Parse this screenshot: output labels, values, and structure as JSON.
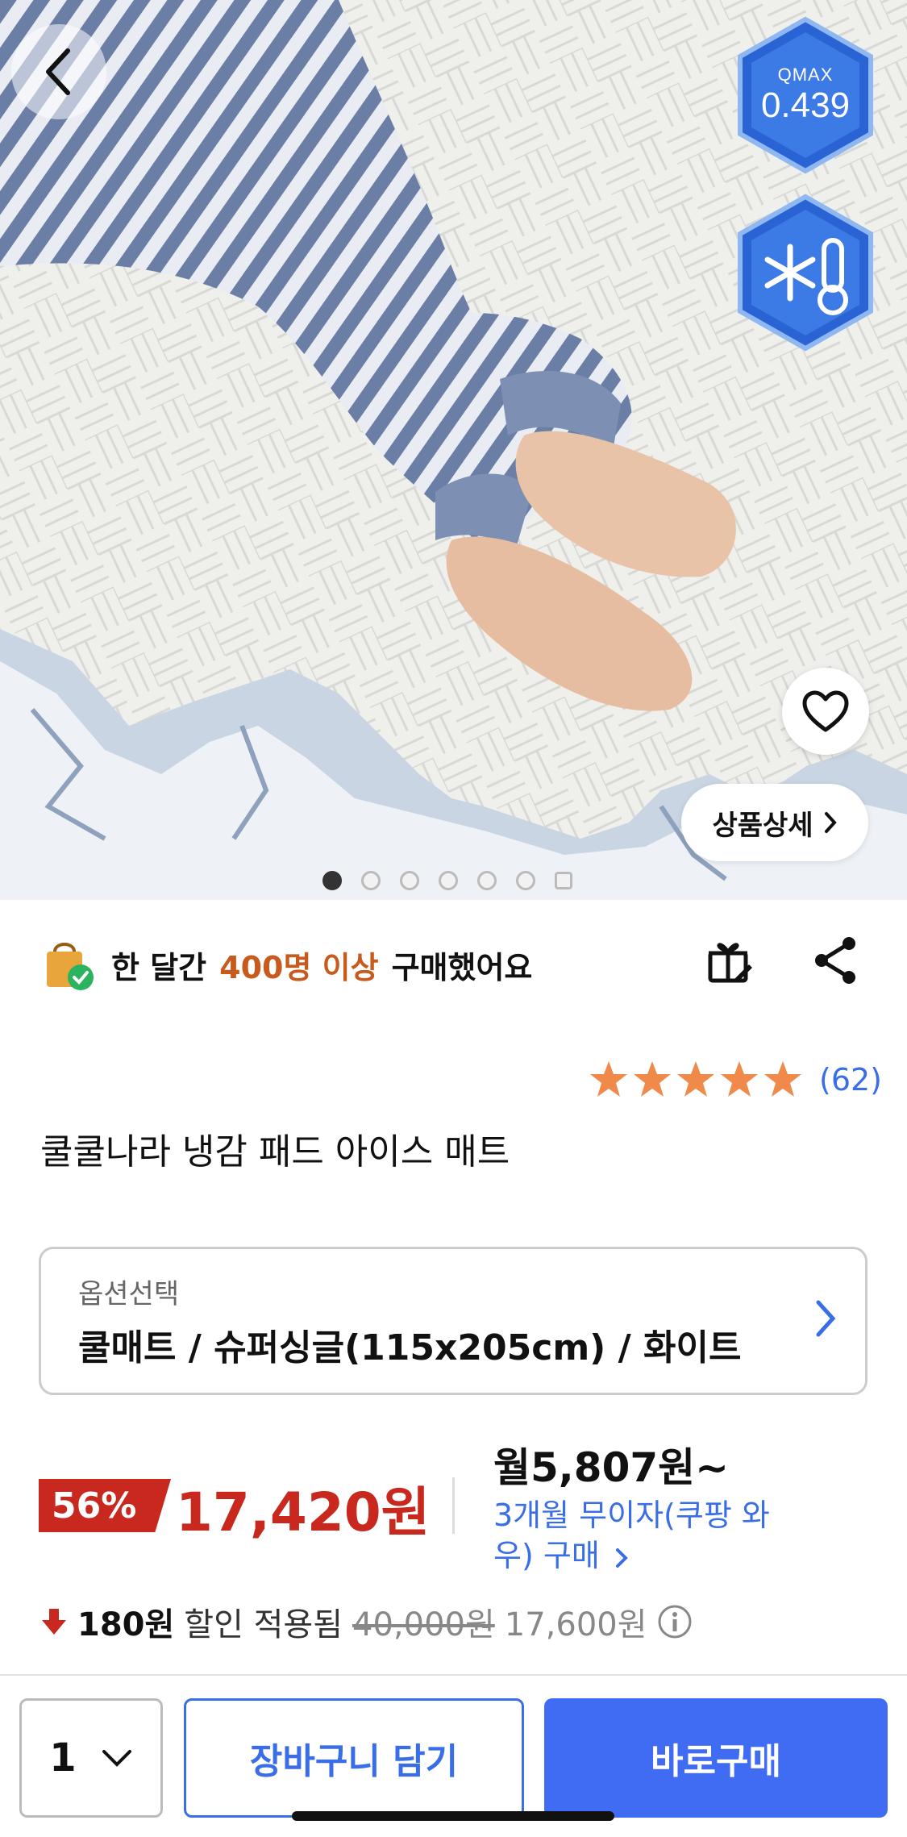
{
  "hero": {
    "badge_qmax_label": "QMAX",
    "badge_qmax_value": "0.439",
    "detail_label": "상품상세",
    "slide_count": 7,
    "active_slide": 1
  },
  "banner": {
    "text_before": "한 달간",
    "highlight": "400명 이상",
    "text_after": "구매했어요"
  },
  "product": {
    "rating_stars": 5,
    "rating_count": "(62)",
    "title": "쿨쿨나라 냉감 패드 아이스 매트"
  },
  "option": {
    "label": "옵션선택",
    "value": "쿨매트 / 슈퍼싱글(115x205cm) / 화이트"
  },
  "price": {
    "discount_rate": "56%",
    "sale_price": "17,420원",
    "monthly": "월5,807원~",
    "monthly_sub": "3개월 무이자(쿠팡 와우) 구매",
    "discount_amount": "180원",
    "discount_applied": "할인 적용됨",
    "original_price": "40,000원",
    "before_coupon": "17,600원"
  },
  "bottom": {
    "quantity": "1",
    "cart_label": "장바구니 담기",
    "buy_label": "바로구매"
  },
  "colors": {
    "accent_blue": "#3f6cf2",
    "price_red": "#c8281d",
    "highlight_orange": "#c75a1c",
    "star_orange": "#f08a4b"
  }
}
